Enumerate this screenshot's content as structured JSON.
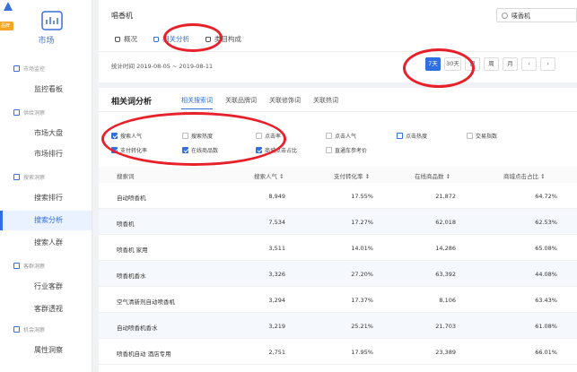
{
  "sidebar": {
    "badge": "品牌",
    "market_label": "市场",
    "groups": [
      {
        "label": "市场监控"
      },
      {
        "label": "供给洞察"
      },
      {
        "label": "搜索洞察"
      },
      {
        "label": "客群洞察"
      },
      {
        "label": "机会洞察"
      }
    ],
    "items": [
      {
        "label": "监控看板"
      },
      {
        "label": "市场大盘"
      },
      {
        "label": "市场排行"
      },
      {
        "label": "搜索排行"
      },
      {
        "label": "搜索分析"
      },
      {
        "label": "搜索人群"
      },
      {
        "label": "行业客群"
      },
      {
        "label": "客群透视"
      },
      {
        "label": "属性洞察"
      }
    ]
  },
  "header": {
    "title": "唱香机",
    "search_value": "唛香机",
    "tabs": [
      {
        "label": "概况"
      },
      {
        "label": "相关分析"
      },
      {
        "label": "类目构成"
      }
    ],
    "stat_time": "统计时间 2019-08-05 ~ 2019-08-11",
    "periods": [
      "7天",
      "30天",
      "日",
      "周",
      "月"
    ]
  },
  "main": {
    "title": "相关词分析",
    "subtabs": [
      "相关搜索词",
      "关联品牌词",
      "关联修饰词",
      "关联热词"
    ],
    "checkboxes": [
      {
        "label": "搜索人气",
        "checked": true
      },
      {
        "label": "搜索热度",
        "checked": false
      },
      {
        "label": "点击率",
        "checked": false
      },
      {
        "label": "点击人气",
        "checked": false
      },
      {
        "label": "点击热度",
        "checked": false
      },
      {
        "label": "交易指数",
        "checked": false
      },
      {
        "label": "支付转化率",
        "checked": true
      },
      {
        "label": "在线商品数",
        "checked": true
      },
      {
        "label": "商城点击占比",
        "checked": true
      },
      {
        "label": "直通车参考价",
        "checked": false
      }
    ],
    "columns": [
      "搜索词",
      "搜索人气",
      "支付转化率",
      "在线商品数",
      "商城点击占比"
    ],
    "rows": [
      [
        "自动喷香机",
        "8,949",
        "17.55%",
        "21,872",
        "64.72%"
      ],
      [
        "喷香机",
        "7,534",
        "17.27%",
        "62,018",
        "62.53%"
      ],
      [
        "喷香机 家用",
        "3,511",
        "14.01%",
        "14,286",
        "65.08%"
      ],
      [
        "喷香机香水",
        "3,326",
        "27.20%",
        "63,392",
        "44.08%"
      ],
      [
        "空气清新剂自动喷香机",
        "3,294",
        "17.37%",
        "8,106",
        "63.43%"
      ],
      [
        "自动喷香机香水",
        "3,219",
        "25.21%",
        "21,703",
        "61.08%"
      ],
      [
        "喷香机自动 酒店专用",
        "2,751",
        "17.95%",
        "23,389",
        "66.01%"
      ]
    ]
  },
  "colors": {
    "accent": "#2f6fe0",
    "annotation": "#e8202a"
  }
}
